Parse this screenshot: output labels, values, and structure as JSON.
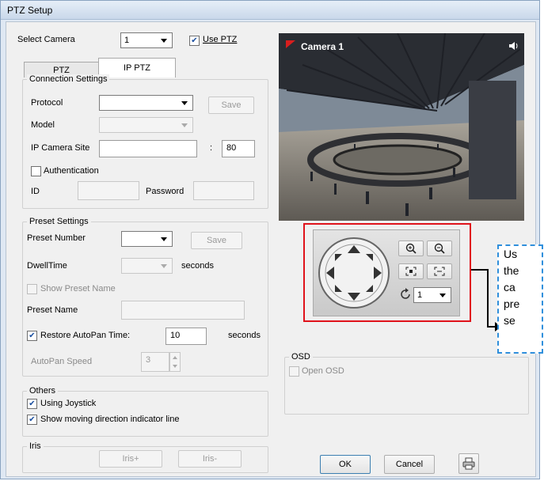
{
  "window": {
    "title": "PTZ Setup"
  },
  "camera": {
    "label": "Select Camera",
    "value": "1",
    "use_ptz_label": "Use PTZ",
    "use_ptz_checked": true
  },
  "tabs": [
    {
      "label": "PTZ",
      "active": false
    },
    {
      "label": "IP PTZ",
      "active": true
    }
  ],
  "connection": {
    "title": "Connection Settings",
    "protocol_label": "Protocol",
    "protocol_value": "",
    "save_label": "Save",
    "model_label": "Model",
    "model_value": "",
    "site_label": "IP Camera Site",
    "site_value": "",
    "colon": ":",
    "port_value": "80",
    "auth_label": "Authentication",
    "auth_checked": false,
    "id_label": "ID",
    "id_value": "",
    "password_label": "Password",
    "password_value": ""
  },
  "preset": {
    "title": "Preset Settings",
    "number_label": "Preset Number",
    "number_value": "",
    "save_label": "Save",
    "dwell_label": "DwellTime",
    "dwell_value": "",
    "dwell_unit": "seconds",
    "show_name_label": "Show Preset Name",
    "show_name_checked": false,
    "name_label": "Preset Name",
    "name_value": "",
    "restore_label": "Restore AutoPan Time:",
    "restore_checked": true,
    "restore_value": "10",
    "restore_unit": "seconds",
    "speed_label": "AutoPan Speed",
    "speed_value": "3"
  },
  "others": {
    "title": "Others",
    "joystick_label": "Using Joystick",
    "joystick_checked": true,
    "indicator_label": "Show moving direction indicator line",
    "indicator_checked": true
  },
  "iris": {
    "title": "Iris",
    "plus_label": "Iris+",
    "minus_label": "Iris-"
  },
  "video": {
    "camera_label": "Camera 1",
    "status_icon": "speaker-icon"
  },
  "ptz_control": {
    "icons": [
      "arrow-up-icon",
      "arrow-down-icon",
      "arrow-left-icon",
      "arrow-right-icon",
      "arrow-up-left-icon",
      "arrow-up-right-icon",
      "arrow-down-left-icon",
      "arrow-down-right-icon",
      "zoom-in-icon",
      "zoom-out-icon",
      "focus-near-icon",
      "focus-far-icon",
      "preset-go-icon"
    ],
    "preset_value": "1"
  },
  "osd": {
    "title": "OSD",
    "open_label": "Open OSD",
    "open_checked": false
  },
  "callout": {
    "lines": [
      "Us",
      "the",
      "ca",
      "pre",
      "se"
    ]
  },
  "footer": {
    "ok_label": "OK",
    "cancel_label": "Cancel",
    "print_icon": "printer-icon"
  },
  "colors": {
    "highlight_border": "#e0121b",
    "callout_border": "#2f8fdc",
    "camera_flag": "#d81e1e"
  }
}
